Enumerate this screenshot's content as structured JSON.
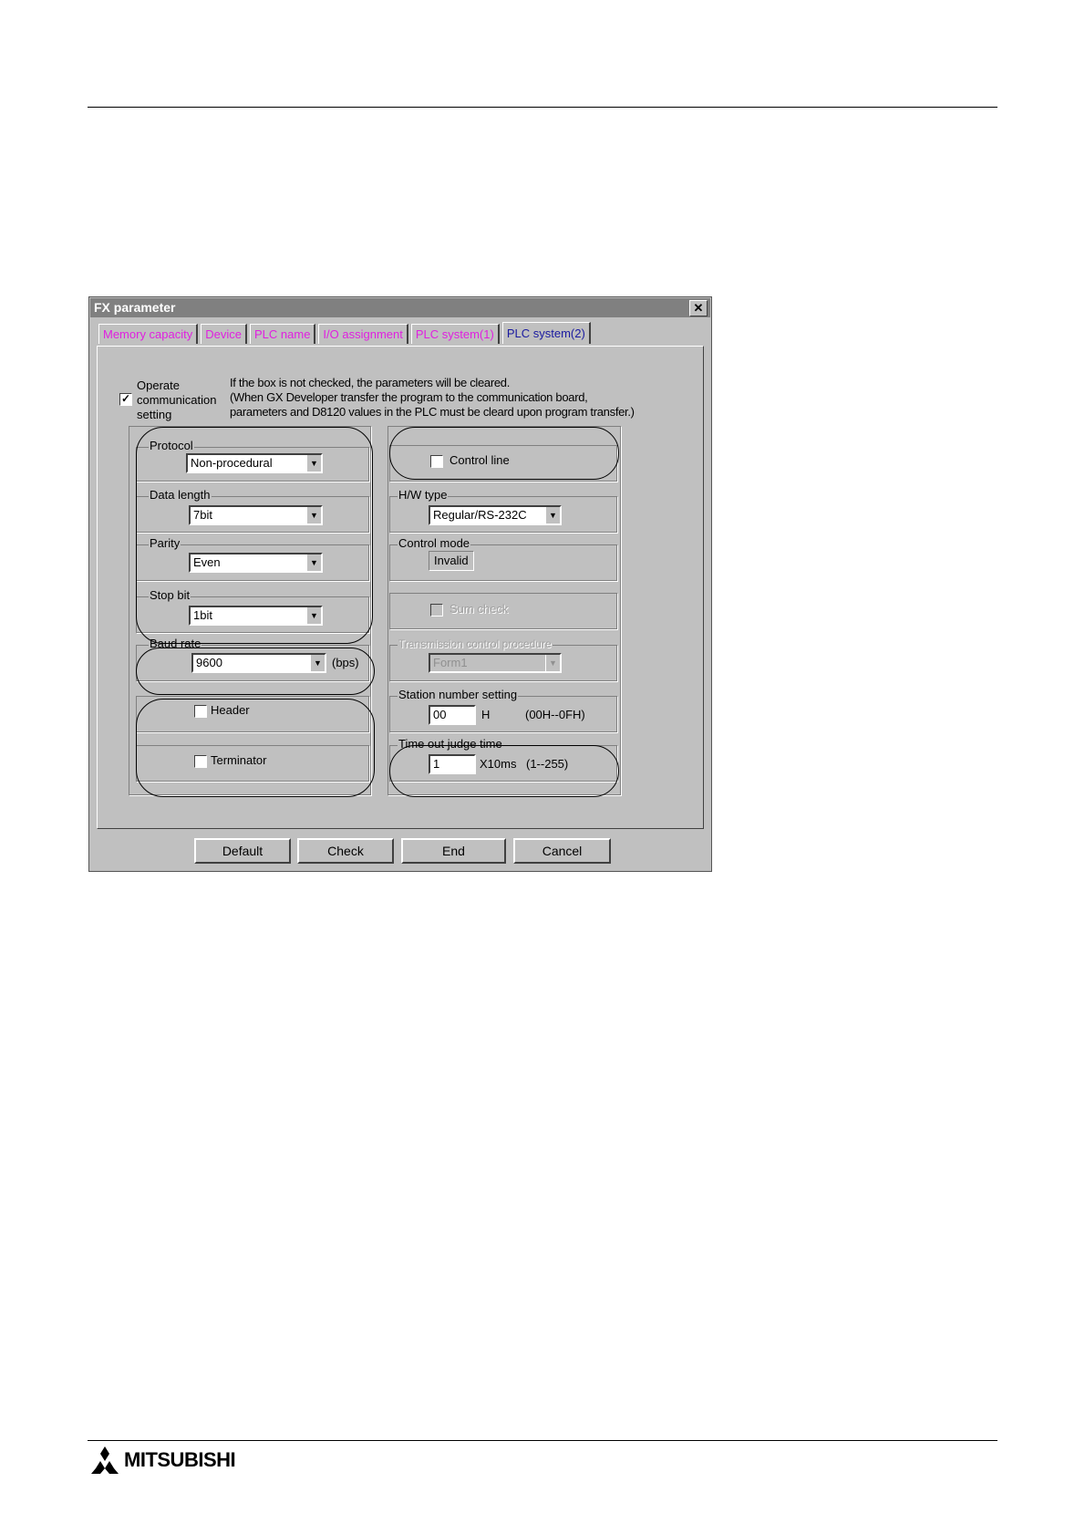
{
  "window": {
    "title": "FX parameter",
    "close_glyph": "✕"
  },
  "tabs": [
    {
      "label": "Memory capacity"
    },
    {
      "label": "Device"
    },
    {
      "label": "PLC name"
    },
    {
      "label": "I/O assignment"
    },
    {
      "label": "PLC system(1)"
    },
    {
      "label": "PLC system(2)"
    }
  ],
  "active_tab": "PLC system(2)",
  "operate": {
    "checked": true,
    "mark": "✓",
    "label_lines": [
      "Operate",
      "communication",
      "setting"
    ],
    "note_lines": [
      "If the box is not checked, the parameters will be cleared.",
      "(When GX Developer transfer the program to the communication board,",
      "parameters and D8120 values in the PLC must be cleard upon program transfer.)"
    ]
  },
  "left": {
    "protocol": {
      "label": "Protocol",
      "value": "Non-procedural"
    },
    "data_length": {
      "label": "Data length",
      "value": "7bit"
    },
    "parity": {
      "label": "Parity",
      "value": "Even"
    },
    "stop_bit": {
      "label": "Stop bit",
      "value": "1bit"
    },
    "baud_rate": {
      "label": "Baud rate",
      "value": "9600",
      "unit": "(bps)"
    },
    "header": {
      "label": "Header",
      "checked": false
    },
    "terminator": {
      "label": "Terminator",
      "checked": false
    }
  },
  "right": {
    "control_line": {
      "label": "Control line",
      "checked": false
    },
    "hw_type": {
      "label": "H/W type",
      "value": "Regular/RS-232C"
    },
    "control_mode": {
      "label": "Control mode",
      "value": "Invalid"
    },
    "sum_check": {
      "label": "Sum check",
      "checked": false
    },
    "transmission": {
      "label": "Transmission control procedure",
      "value": "Form1"
    },
    "station": {
      "label": "Station number setting",
      "value": "00",
      "unit": "H",
      "range": "(00H--0FH)"
    },
    "timeout": {
      "label": "Time out judge time",
      "value": "1",
      "unit": "X10ms",
      "range": "(1--255)"
    }
  },
  "buttons": {
    "default": "Default",
    "check": "Check",
    "end": "End",
    "cancel": "Cancel"
  },
  "footer": {
    "logo_text": "MITSUBISHI"
  },
  "arrow_glyph": "▼"
}
